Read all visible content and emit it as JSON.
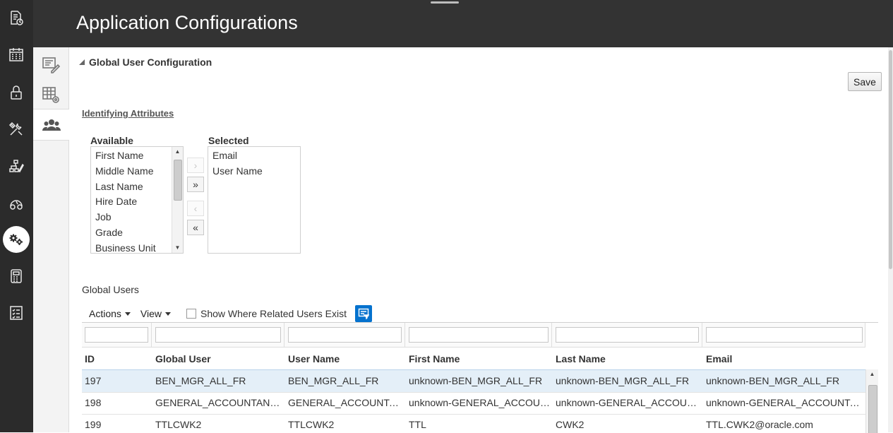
{
  "header": {
    "title": "Application Configurations"
  },
  "rail": {
    "items": [
      {
        "name": "reports-icon"
      },
      {
        "name": "calendar-icon"
      },
      {
        "name": "lock-icon"
      },
      {
        "name": "tools-icon"
      },
      {
        "name": "hierarchy-edit-icon"
      },
      {
        "name": "dashboard-icon"
      },
      {
        "name": "gears-icon",
        "active": true
      },
      {
        "name": "calculator-icon"
      },
      {
        "name": "checklist-icon"
      }
    ]
  },
  "vertical_tabs": [
    {
      "name": "edit-config-icon"
    },
    {
      "name": "table-settings-icon"
    },
    {
      "name": "users-icon",
      "active": true
    }
  ],
  "section": {
    "title": "Global User Configuration",
    "save_label": "Save",
    "identifying_attributes_label": "Identifying Attributes"
  },
  "shuttle": {
    "available_label": "Available",
    "selected_label": "Selected",
    "available": [
      "First Name",
      "Middle Name",
      "Last Name",
      "Hire Date",
      "Job",
      "Grade",
      "Business Unit"
    ],
    "selected": [
      "Email",
      "User Name"
    ],
    "buttons": {
      "move": "›",
      "move_all": "»",
      "remove": "‹",
      "remove_all": "«"
    }
  },
  "global_users": {
    "label": "Global Users",
    "toolbar": {
      "actions_label": "Actions",
      "view_label": "View",
      "related_checkbox_label": "Show Where Related Users Exist",
      "related_checked": false
    },
    "columns": [
      "ID",
      "Global User",
      "User Name",
      "First Name",
      "Last Name",
      "Email"
    ],
    "rows": [
      [
        "197",
        "BEN_MGR_ALL_FR",
        "BEN_MGR_ALL_FR",
        "unknown-BEN_MGR_ALL_FR",
        "unknown-BEN_MGR_ALL_FR",
        "unknown-BEN_MGR_ALL_FR"
      ],
      [
        "198",
        "GENERAL_ACCOUNTANT_…",
        "GENERAL_ACCOUNTAN…",
        "unknown-GENERAL_ACCOUN…",
        "unknown-GENERAL_ACCOUNT…",
        "unknown-GENERAL_ACCOUNTAN…"
      ],
      [
        "199",
        "TTLCWK2",
        "TTLCWK2",
        "TTL",
        "CWK2",
        "TTL.CWK2@oracle.com"
      ]
    ],
    "selected_row": 0
  }
}
